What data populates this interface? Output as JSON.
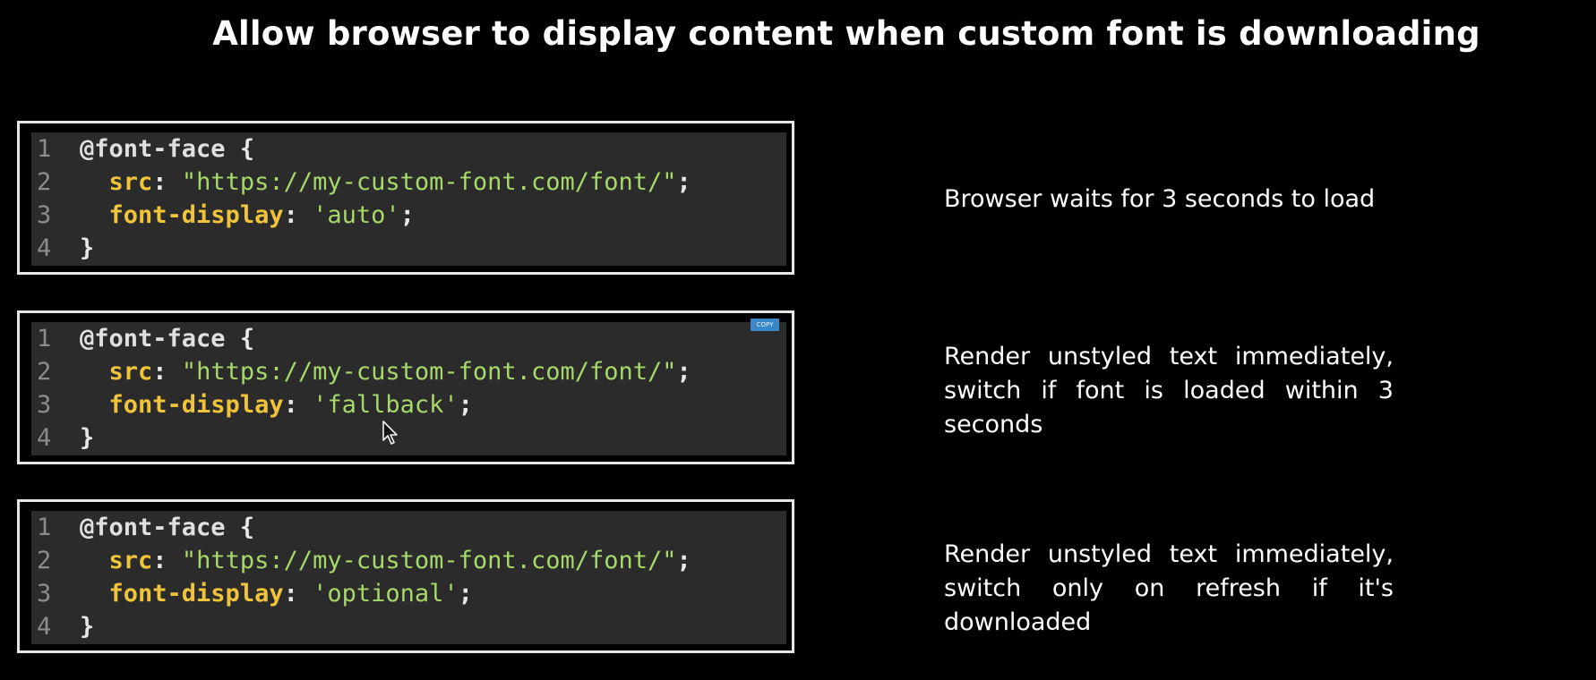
{
  "title": "Allow browser to display content when custom font is downloading",
  "blocks": [
    {
      "line_numbers": [
        "1",
        "2",
        "3",
        "4"
      ],
      "at_rule": "@font-face",
      "open_brace": " {",
      "src_prop": "src",
      "src_colon": ": ",
      "src_value": "\"https://my-custom-font.com/font/\"",
      "src_semicolon": ";",
      "display_prop": "font-display",
      "display_colon": ": ",
      "display_value": "'auto'",
      "display_semicolon": ";",
      "close_brace": "}",
      "description": "Browser waits for 3 seconds to load"
    },
    {
      "line_numbers": [
        "1",
        "2",
        "3",
        "4"
      ],
      "at_rule": "@font-face",
      "open_brace": " {",
      "src_prop": "src",
      "src_colon": ": ",
      "src_value": "\"https://my-custom-font.com/font/\"",
      "src_semicolon": ";",
      "display_prop": "font-display",
      "display_colon": ": ",
      "display_value": "'fallback'",
      "display_semicolon": ";",
      "close_brace": "}",
      "copy_label": "COPY",
      "description": "Render unstyled text immediately, switch if font is loaded within 3 seconds"
    },
    {
      "line_numbers": [
        "1",
        "2",
        "3",
        "4"
      ],
      "at_rule": "@font-face",
      "open_brace": " {",
      "src_prop": "src",
      "src_colon": ": ",
      "src_value": "\"https://my-custom-font.com/font/\"",
      "src_semicolon": ";",
      "display_prop": "font-display",
      "display_colon": ": ",
      "display_value": "'optional'",
      "display_semicolon": ";",
      "close_brace": "}",
      "description": "Render unstyled text immediately, switch only on refresh if it's downloaded"
    }
  ],
  "icons": {
    "cursor": "mouse-pointer-icon"
  },
  "colors": {
    "background": "#000000",
    "code_background": "#2b2b2b",
    "border": "#e6e6e6",
    "property": "#f0c43a",
    "string": "#a6d86a",
    "line_number": "#8c8c8c",
    "copy_button": "#3a87c8"
  }
}
